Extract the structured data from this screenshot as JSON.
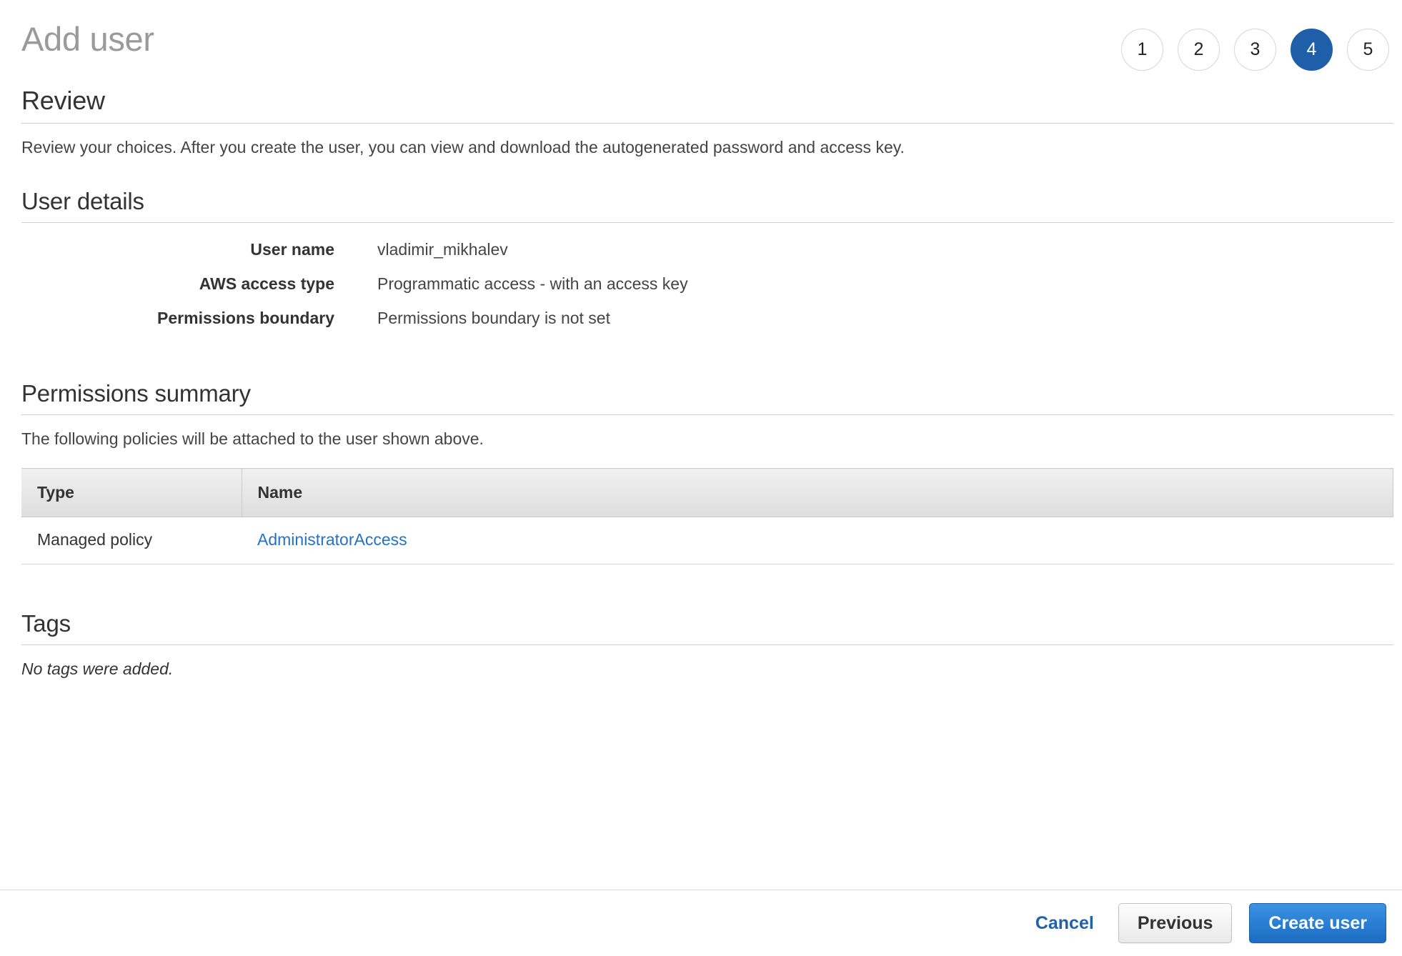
{
  "header": {
    "title": "Add user",
    "steps": [
      {
        "label": "1",
        "active": false
      },
      {
        "label": "2",
        "active": false
      },
      {
        "label": "3",
        "active": false
      },
      {
        "label": "4",
        "active": true
      },
      {
        "label": "5",
        "active": false
      }
    ]
  },
  "review": {
    "title": "Review",
    "description": "Review your choices. After you create the user, you can view and download the autogenerated password and access key."
  },
  "user_details": {
    "title": "User details",
    "rows": [
      {
        "label": "User name",
        "value": "vladimir_mikhalev"
      },
      {
        "label": "AWS access type",
        "value": "Programmatic access - with an access key"
      },
      {
        "label": "Permissions boundary",
        "value": "Permissions boundary is not set"
      }
    ]
  },
  "permissions_summary": {
    "title": "Permissions summary",
    "description": "The following policies will be attached to the user shown above.",
    "columns": [
      "Type",
      "Name"
    ],
    "rows": [
      {
        "type": "Managed policy",
        "name": "AdministratorAccess"
      }
    ]
  },
  "tags": {
    "title": "Tags",
    "empty_message": "No tags were added."
  },
  "footer": {
    "cancel_label": "Cancel",
    "previous_label": "Previous",
    "create_label": "Create user"
  },
  "colors": {
    "active_step": "#1f5fa9",
    "link": "#2372c8",
    "primary_button": "#2a7fd4",
    "cancel_link": "#2061ac",
    "rule": "#cfcfcf"
  }
}
